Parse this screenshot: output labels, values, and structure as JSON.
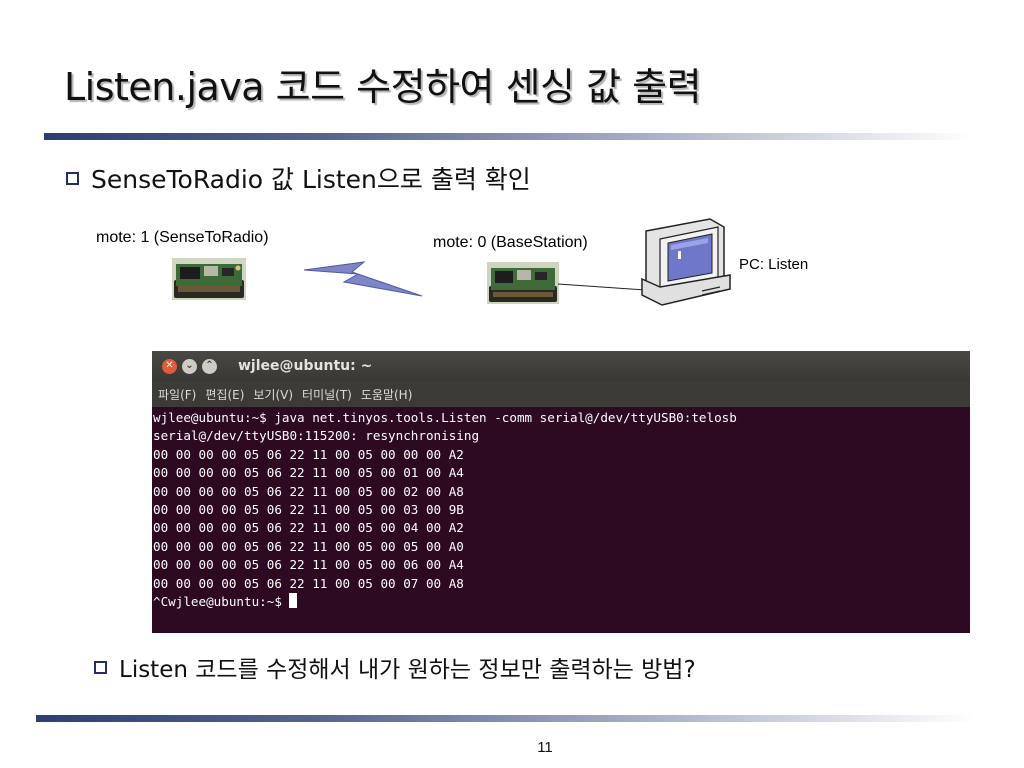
{
  "slide": {
    "title": "Listen.java 코드 수정하여 센싱 값 출력",
    "bullet1": "SenseToRadio 값 Listen으로 출력 확인",
    "bullet2": "Listen 코드를 수정해서 내가 원하는 정보만 출력하는 방법?",
    "page_number": "11"
  },
  "diagram": {
    "mote1_label": "mote: 1 (SenseToRadio)",
    "mote0_label": "mote: 0 (BaseStation)",
    "pc_label": "PC: Listen"
  },
  "terminal": {
    "title": "wjlee@ubuntu: ~",
    "menu": [
      "파일(F)",
      "편집(E)",
      "보기(V)",
      "터미널(T)",
      "도움말(H)"
    ],
    "lines": [
      "wjlee@ubuntu:~$ java net.tinyos.tools.Listen -comm serial@/dev/ttyUSB0:telosb",
      "serial@/dev/ttyUSB0:115200: resynchronising",
      "00 00 00 00 05 06 22 11 00 05 00 00 00 A2",
      "00 00 00 00 05 06 22 11 00 05 00 01 00 A4",
      "00 00 00 00 05 06 22 11 00 05 00 02 00 A8",
      "00 00 00 00 05 06 22 11 00 05 00 03 00 9B",
      "00 00 00 00 05 06 22 11 00 05 00 04 00 A2",
      "00 00 00 00 05 06 22 11 00 05 00 05 00 A0",
      "00 00 00 00 05 06 22 11 00 05 00 06 00 A4",
      "00 00 00 00 05 06 22 11 00 05 00 07 00 A8"
    ],
    "prompt_line": "^Cwjlee@ubuntu:~$ "
  }
}
